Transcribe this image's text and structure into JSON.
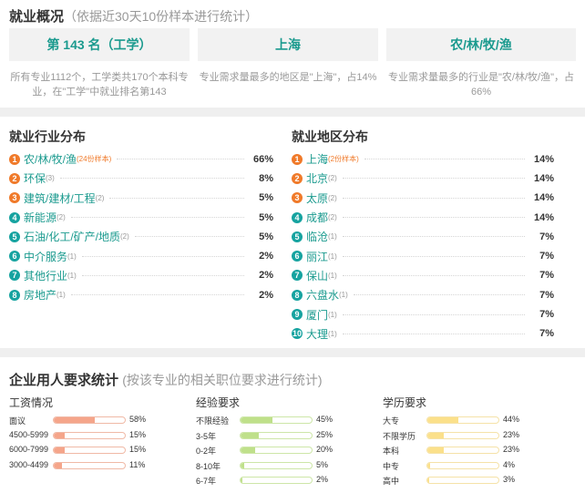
{
  "overview": {
    "title": "就业概况",
    "subtitle": "（依据近30天10份样本进行统计）",
    "boxes": [
      {
        "label": "第 143 名（工学）",
        "desc": "所有专业1112个，工学类共170个本科专业，在\"工学\"中就业排名第143"
      },
      {
        "label": "上海",
        "desc": "专业需求量最多的地区是\"上海\"，占14%"
      },
      {
        "label": "农/林/牧/渔",
        "desc": "专业需求量最多的行业是\"农/林/牧/渔\"，占66%"
      }
    ]
  },
  "industry": {
    "title": "就业行业分布",
    "items": [
      {
        "rank": "1",
        "name": "农/林/牧/渔",
        "count": "(24份样本)",
        "pct": "66%"
      },
      {
        "rank": "2",
        "name": "环保",
        "count": "(3)",
        "pct": "8%"
      },
      {
        "rank": "3",
        "name": "建筑/建材/工程",
        "count": "(2)",
        "pct": "5%"
      },
      {
        "rank": "4",
        "name": "新能源",
        "count": "(2)",
        "pct": "5%"
      },
      {
        "rank": "5",
        "name": "石油/化工/矿产/地质",
        "count": "(2)",
        "pct": "5%"
      },
      {
        "rank": "6",
        "name": "中介服务",
        "count": "(1)",
        "pct": "2%"
      },
      {
        "rank": "7",
        "name": "其他行业",
        "count": "(1)",
        "pct": "2%"
      },
      {
        "rank": "8",
        "name": "房地产",
        "count": "(1)",
        "pct": "2%"
      }
    ]
  },
  "region": {
    "title": "就业地区分布",
    "items": [
      {
        "rank": "1",
        "name": "上海",
        "count": "(2份样本)",
        "pct": "14%"
      },
      {
        "rank": "2",
        "name": "北京",
        "count": "(2)",
        "pct": "14%"
      },
      {
        "rank": "3",
        "name": "太原",
        "count": "(2)",
        "pct": "14%"
      },
      {
        "rank": "4",
        "name": "成都",
        "count": "(2)",
        "pct": "14%"
      },
      {
        "rank": "5",
        "name": "临沧",
        "count": "(1)",
        "pct": "7%"
      },
      {
        "rank": "6",
        "name": "丽江",
        "count": "(1)",
        "pct": "7%"
      },
      {
        "rank": "7",
        "name": "保山",
        "count": "(1)",
        "pct": "7%"
      },
      {
        "rank": "8",
        "name": "六盘水",
        "count": "(1)",
        "pct": "7%"
      },
      {
        "rank": "9",
        "name": "厦门",
        "count": "(1)",
        "pct": "7%"
      },
      {
        "rank": "10",
        "name": "大理",
        "count": "(1)",
        "pct": "7%"
      }
    ]
  },
  "requirements": {
    "title": "企业用人要求统计",
    "subtitle": "(按该专业的相关职位要求进行统计)",
    "columns": [
      {
        "title": "工资情况",
        "color": "#f5a58a",
        "border": "#f0b9a6",
        "items": [
          {
            "label": "面议",
            "pct": "58%",
            "value": 58
          },
          {
            "label": "4500-5999",
            "pct": "15%",
            "value": 15
          },
          {
            "label": "6000-7999",
            "pct": "15%",
            "value": 15
          },
          {
            "label": "3000-4499",
            "pct": "11%",
            "value": 11
          }
        ]
      },
      {
        "title": "经验要求",
        "color": "#bfe08a",
        "border": "#cde6a8",
        "items": [
          {
            "label": "不限经验",
            "pct": "45%",
            "value": 45
          },
          {
            "label": "3-5年",
            "pct": "25%",
            "value": 25
          },
          {
            "label": "0-2年",
            "pct": "20%",
            "value": 20
          },
          {
            "label": "8-10年",
            "pct": "5%",
            "value": 5
          },
          {
            "label": "6-7年",
            "pct": "2%",
            "value": 2
          }
        ]
      },
      {
        "title": "学历要求",
        "color": "#fbe08a",
        "border": "#f5e2a8",
        "items": [
          {
            "label": "大专",
            "pct": "44%",
            "value": 44
          },
          {
            "label": "不限学历",
            "pct": "23%",
            "value": 23
          },
          {
            "label": "本科",
            "pct": "23%",
            "value": 23
          },
          {
            "label": "中专",
            "pct": "4%",
            "value": 4
          },
          {
            "label": "高中",
            "pct": "3%",
            "value": 3
          }
        ]
      }
    ]
  }
}
